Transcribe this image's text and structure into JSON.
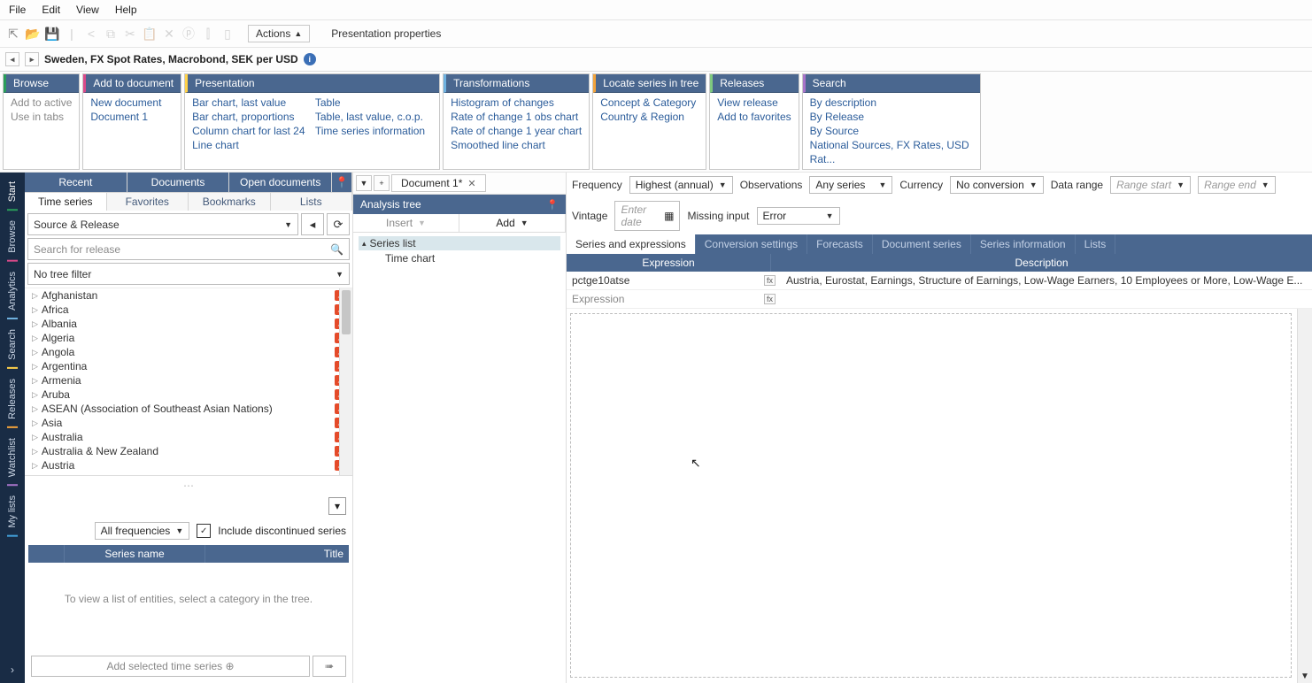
{
  "menubar": [
    "File",
    "Edit",
    "View",
    "Help"
  ],
  "toolbar": {
    "actions": "Actions",
    "presprops": "Presentation properties"
  },
  "title": "Sweden, FX Spot Rates, Macrobond, SEK per USD",
  "panels": {
    "browse": {
      "hdr": "Browse",
      "items": [
        "Add to active",
        "Use in tabs"
      ]
    },
    "addtodoc": {
      "hdr": "Add to document",
      "items": [
        "New document",
        "Document 1"
      ]
    },
    "presentation": {
      "hdr": "Presentation",
      "col1": [
        "Bar chart, last value",
        "Bar chart, proportions",
        "Column chart for last 24",
        "Line chart"
      ],
      "col2": [
        "Table",
        "Table, last value, c.o.p.",
        "Time series information"
      ]
    },
    "transforms": {
      "hdr": "Transformations",
      "items": [
        "Histogram of changes",
        "Rate of change 1 obs chart",
        "Rate of change 1 year chart",
        "Smoothed line chart"
      ]
    },
    "locate": {
      "hdr": "Locate series in tree",
      "items": [
        "Concept & Category",
        "Country & Region"
      ]
    },
    "releases": {
      "hdr": "Releases",
      "items": [
        "View release",
        "Add to favorites"
      ]
    },
    "search": {
      "hdr": "Search",
      "items": [
        "By description",
        "By Release",
        "By Source",
        "National Sources, FX Rates, USD Rat..."
      ]
    }
  },
  "vtabs": [
    "Start",
    "Browse",
    "Analytics",
    "Search",
    "Releases",
    "Watchlist",
    "My lists"
  ],
  "lefttabs1": [
    "Recent",
    "Documents",
    "Open documents"
  ],
  "lefttabs2": [
    "Time series",
    "Favorites",
    "Bookmarks",
    "Lists"
  ],
  "source_release": "Source & Release",
  "search_ph": "Search for release",
  "tree_filter": "No tree filter",
  "treeitems": [
    "Afghanistan",
    "Africa",
    "Albania",
    "Algeria",
    "Angola",
    "Argentina",
    "Armenia",
    "Aruba",
    "ASEAN (Association of Southeast Asian Nations)",
    "Asia",
    "Australia",
    "Australia & New Zealand",
    "Austria"
  ],
  "freq_sel": "All frequencies",
  "include_disc": "Include discontinued series",
  "series_cols": {
    "name": "Series name",
    "title": "Title"
  },
  "empty_msg": "To view a list of entities, select a category in the tree.",
  "add_selected": "Add selected time series",
  "doc_tab": "Document 1*",
  "analysis_tree": "Analysis tree",
  "at_insert": "Insert",
  "at_add": "Add",
  "at_series": "Series list",
  "at_chart": "Time chart",
  "opts": {
    "freq": "Frequency",
    "freq_v": "Highest (annual)",
    "obs": "Observations",
    "obs_v": "Any series",
    "cur": "Currency",
    "cur_v": "No conversion",
    "dr": "Data range",
    "drs_ph": "Range start",
    "dre_ph": "Range end",
    "vint": "Vintage",
    "vint_ph": "Enter date",
    "miss": "Missing input",
    "miss_v": "Error"
  },
  "subtabs": [
    "Series and expressions",
    "Conversion settings",
    "Forecasts",
    "Document series",
    "Series information",
    "Lists"
  ],
  "expr_cols": {
    "e": "Expression",
    "d": "Description"
  },
  "rows": [
    {
      "e": "pctge10atse",
      "d": "Austria, Eurostat, Earnings, Structure of Earnings, Low-Wage Earners, 10 Employees or More, Low-Wage E..."
    },
    {
      "e": "Expression",
      "d": ""
    }
  ]
}
